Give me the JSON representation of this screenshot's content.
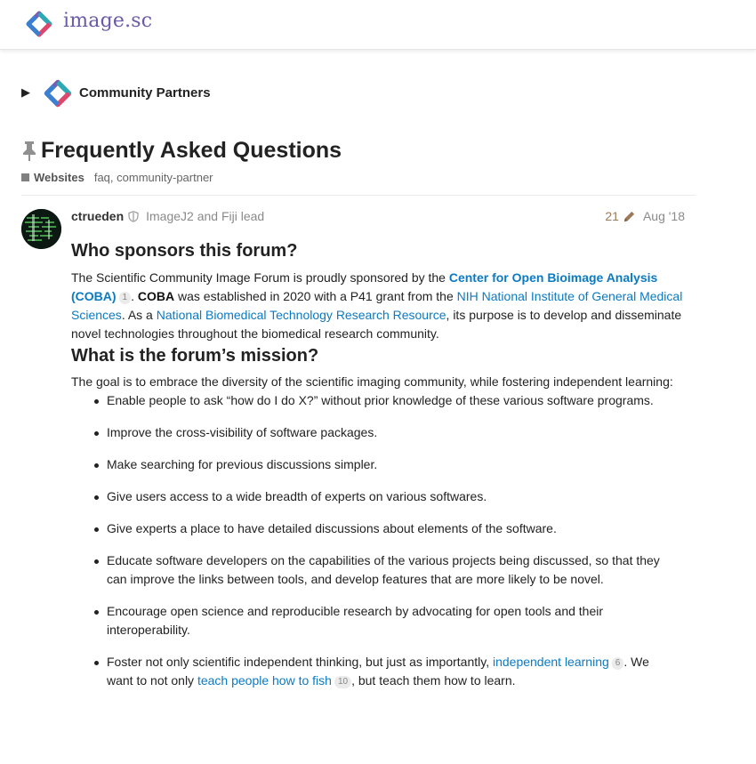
{
  "header": {
    "site_name": "image.sc"
  },
  "category": {
    "toggle_glyph": "▶",
    "name": "Community Partners"
  },
  "topic": {
    "title": "Frequently Asked Questions",
    "category_badge": "Websites",
    "tags": "faq, community-partner"
  },
  "post": {
    "username": "ctrueden",
    "user_title": "ImageJ2 and Fiji lead",
    "edit_count": "21",
    "date": "Aug '18",
    "sponsor_heading": "Who sponsors this forum?",
    "sponsor": {
      "t1": "The Scientific Community Image Forum is proudly sponsored by the ",
      "link1": "Center for Open Bioimage Analysis (COBA)",
      "count1": "1",
      "t2": ". ",
      "bold1": "COBA",
      "t3": " was established in 2020 with a P41 grant from the ",
      "link2": "NIH National Institute of General Medical Sciences",
      "t4": ". As a ",
      "link3": "National Biomedical Technology Research Resource",
      "t5": ", its purpose is to develop and disseminate novel technologies throughout the biomedical research community."
    },
    "mission_heading": "What is the forum’s mission?",
    "mission_intro": "The goal is to embrace the diversity of the scientific imaging community, while fostering independent learning:",
    "mission_items": [
      "Enable people to ask “how do I do X?” without prior knowledge of these various software programs.",
      "Improve the cross-visibility of software packages.",
      "Make searching for previous discussions simpler.",
      "Give users access to a wide breadth of experts on various softwares.",
      "Give experts a place to have detailed discussions about elements of the software.",
      "Educate software developers on the capabilities of the various projects being discussed, so that they can improve the links between tools, and develop features that are more likely to be novel.",
      "Encourage open science and reproducible research by advocating for open tools and their interoperability."
    ],
    "last_item": {
      "t1": "Foster not only scientific independent thinking, but just as importantly, ",
      "link1": "independent learning",
      "count1": "6",
      "t2": ". We want to not only ",
      "link2": "teach people how to fish",
      "count2": "10",
      "t3": ", but teach them how to learn."
    }
  },
  "icons": {
    "logo": "image-sc-logo",
    "pin": "pin-icon",
    "shield": "moderator-shield-icon",
    "pencil": "pencil-icon"
  },
  "colors": {
    "link": "#0a7ac3",
    "brand_text": "#6b5aa8",
    "edit_count": "#9c7a58",
    "category_square": "#808080"
  }
}
